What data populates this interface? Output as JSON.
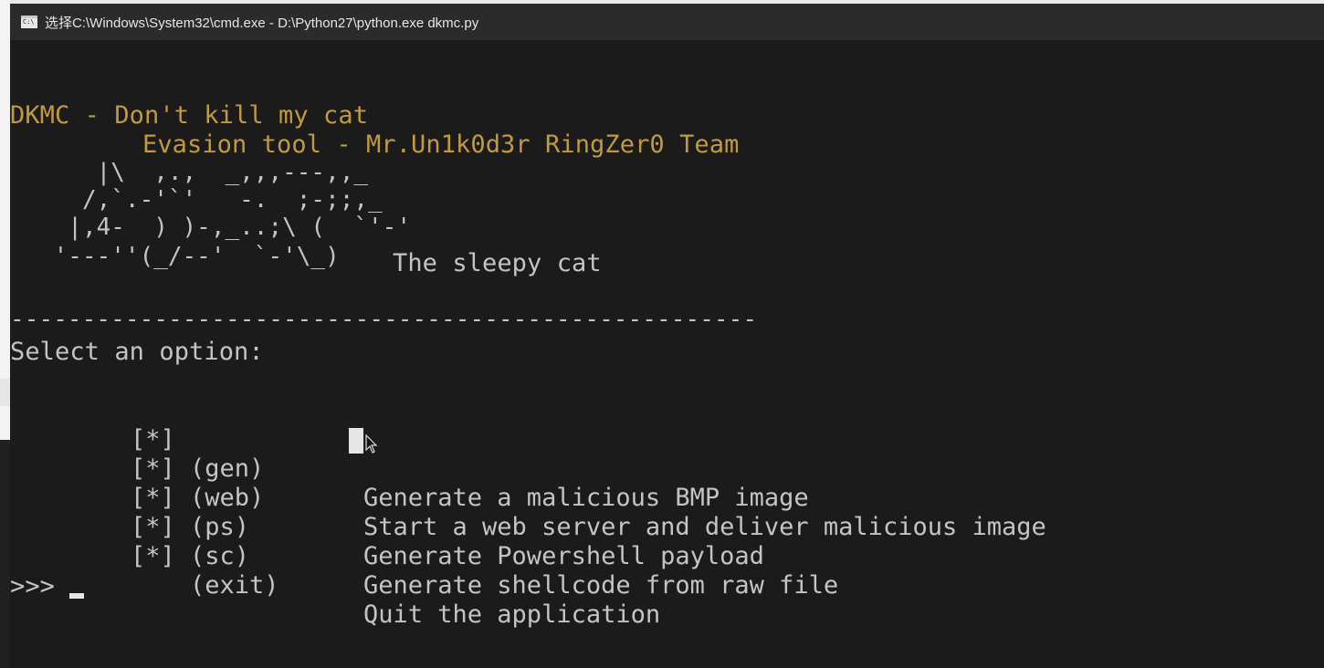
{
  "window": {
    "title": "选择C:\\Windows\\System32\\cmd.exe - D:\\Python27\\python.exe  dkmc.py",
    "icon": "cmd-icon",
    "icon_text": "C:\\"
  },
  "banner": {
    "line1": "DKMC - Don't kill my cat",
    "line2": "Evasion tool - Mr.Un1k0d3r RingZer0 Team"
  },
  "ascii_art": {
    "lines": [
      "    |\\  ,.,  _,,,---,,_",
      "   /,`.-'`'   -.  ;-;;,_",
      "  |,4-  ) )-,_..;\\ (  `'-'",
      " '---''(_/--'  `-'\\_)"
    ],
    "caption": "The sleepy cat"
  },
  "separator": "----------------------------------------------------",
  "prompt_heading": "Select an option:",
  "options": [
    {
      "bullet": "[*]",
      "command": "(gen)",
      "description": "Generate a malicious BMP image"
    },
    {
      "bullet": "[*]",
      "command": "(web)",
      "description": "Start a web server and deliver malicious image"
    },
    {
      "bullet": "[*]",
      "command": "(ps)",
      "description": "Generate Powershell payload"
    },
    {
      "bullet": "[*]",
      "command": "(sc)",
      "description": "Generate shellcode from raw file"
    },
    {
      "bullet": "[*]",
      "command": "(exit)",
      "description": "Quit the application"
    }
  ],
  "input_prompt": ">>> ",
  "colors": {
    "banner": "#c29a3c",
    "text": "#c4c4c4",
    "background": "#1b1b1b"
  }
}
